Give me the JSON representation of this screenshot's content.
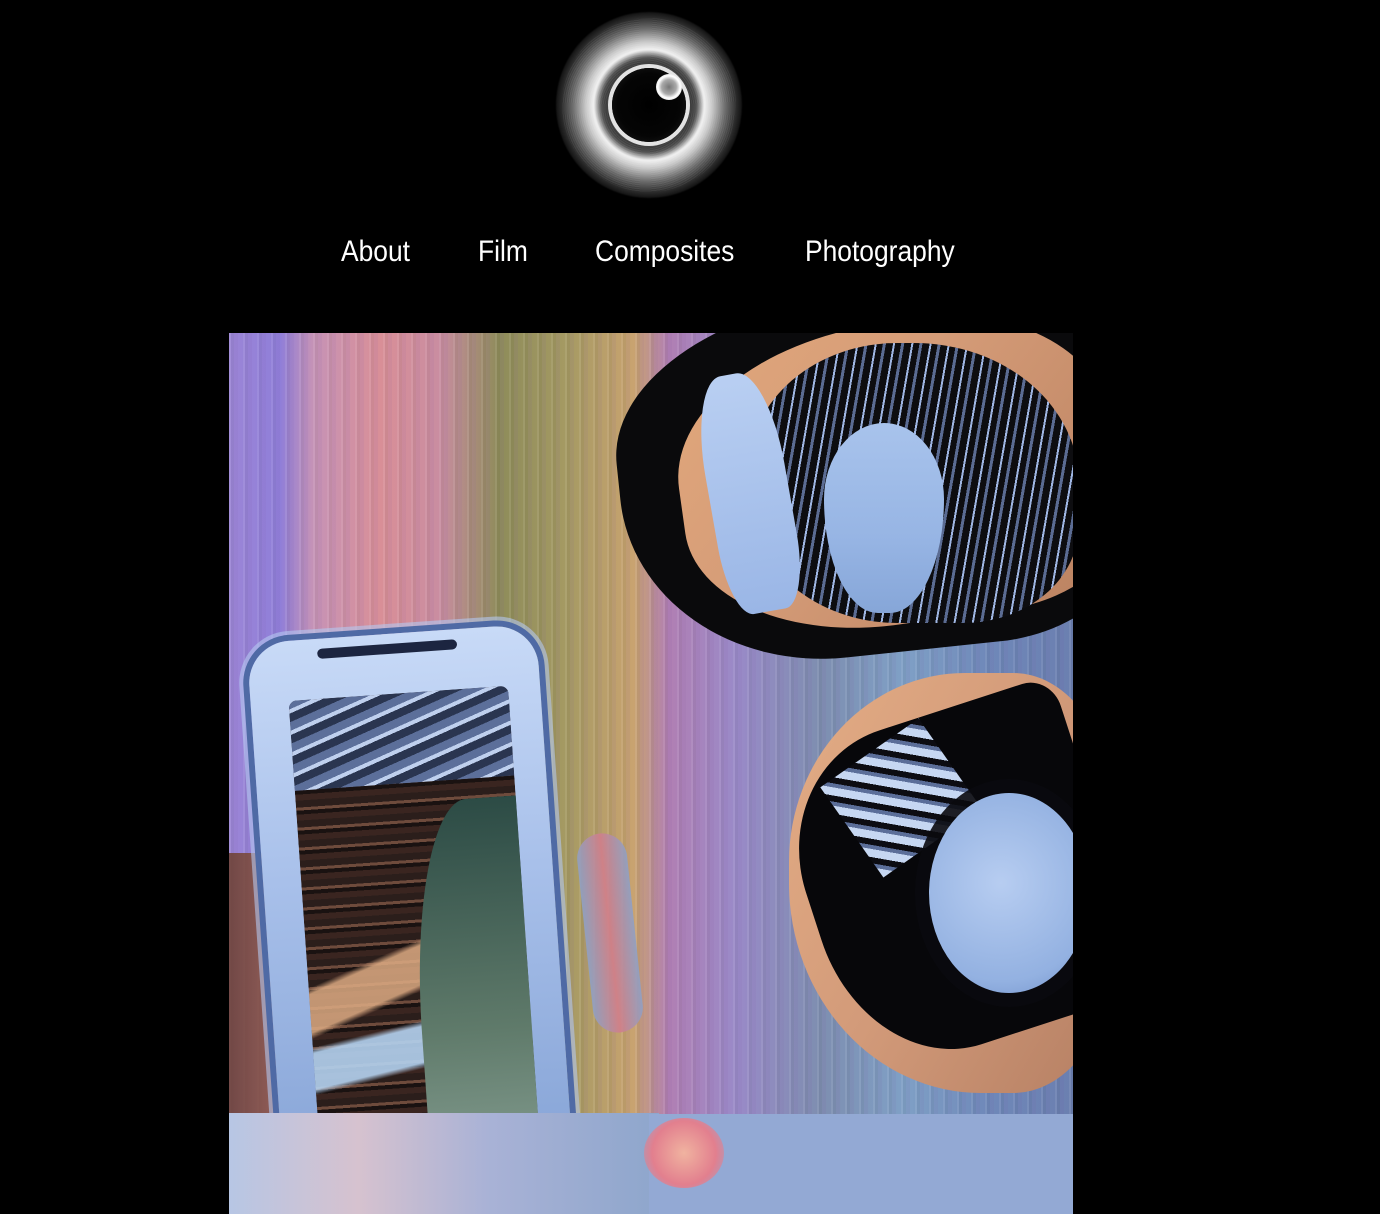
{
  "logo": {
    "icon": "glowing-ring-logo"
  },
  "nav": {
    "items": [
      {
        "label": "About"
      },
      {
        "label": "Film"
      },
      {
        "label": "Composites"
      },
      {
        "label": "Photography"
      }
    ]
  },
  "hero": {
    "icon": "glitch-composite-artwork",
    "colors": {
      "background": "#000000",
      "lavender": "#9c86d6",
      "pink": "#d98f97",
      "ochre": "#a59a63",
      "skin_blue": "#a8c3ec",
      "warm": "#e2a87b"
    }
  }
}
